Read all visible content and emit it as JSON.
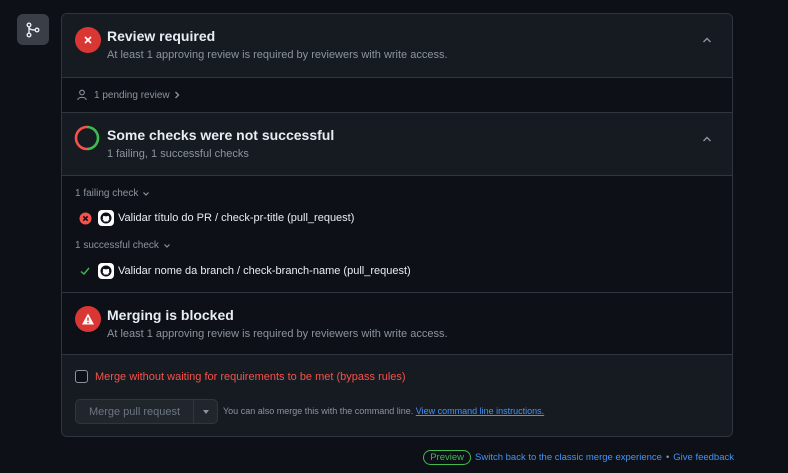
{
  "review": {
    "title": "Review required",
    "subtitle": "At least 1 approving review is required by reviewers with write access.",
    "pending": "1 pending review"
  },
  "checks": {
    "title": "Some checks were not successful",
    "subtitle": "1 failing, 1 successful checks",
    "failing_label": "1 failing check",
    "failing_items": [
      "Validar título do PR / check-pr-title (pull_request)"
    ],
    "successful_label": "1 successful check",
    "successful_items": [
      "Validar nome da branch / check-branch-name (pull_request)"
    ]
  },
  "blocked": {
    "title": "Merging is blocked",
    "subtitle": "At least 1 approving review is required by reviewers with write access."
  },
  "bypass": {
    "label": "Merge without waiting for requirements to be met (bypass rules)"
  },
  "merge": {
    "button_label": "Merge pull request",
    "hint": "You can also merge this with the command line.",
    "hint_link": "View command line instructions."
  },
  "footer": {
    "badge": "Preview",
    "switch_link": "Switch back to the classic merge experience",
    "separator": "•",
    "feedback_link": "Give feedback"
  },
  "colors": {
    "danger": "#da3633",
    "success": "#3fb950",
    "link": "#4493f8"
  }
}
